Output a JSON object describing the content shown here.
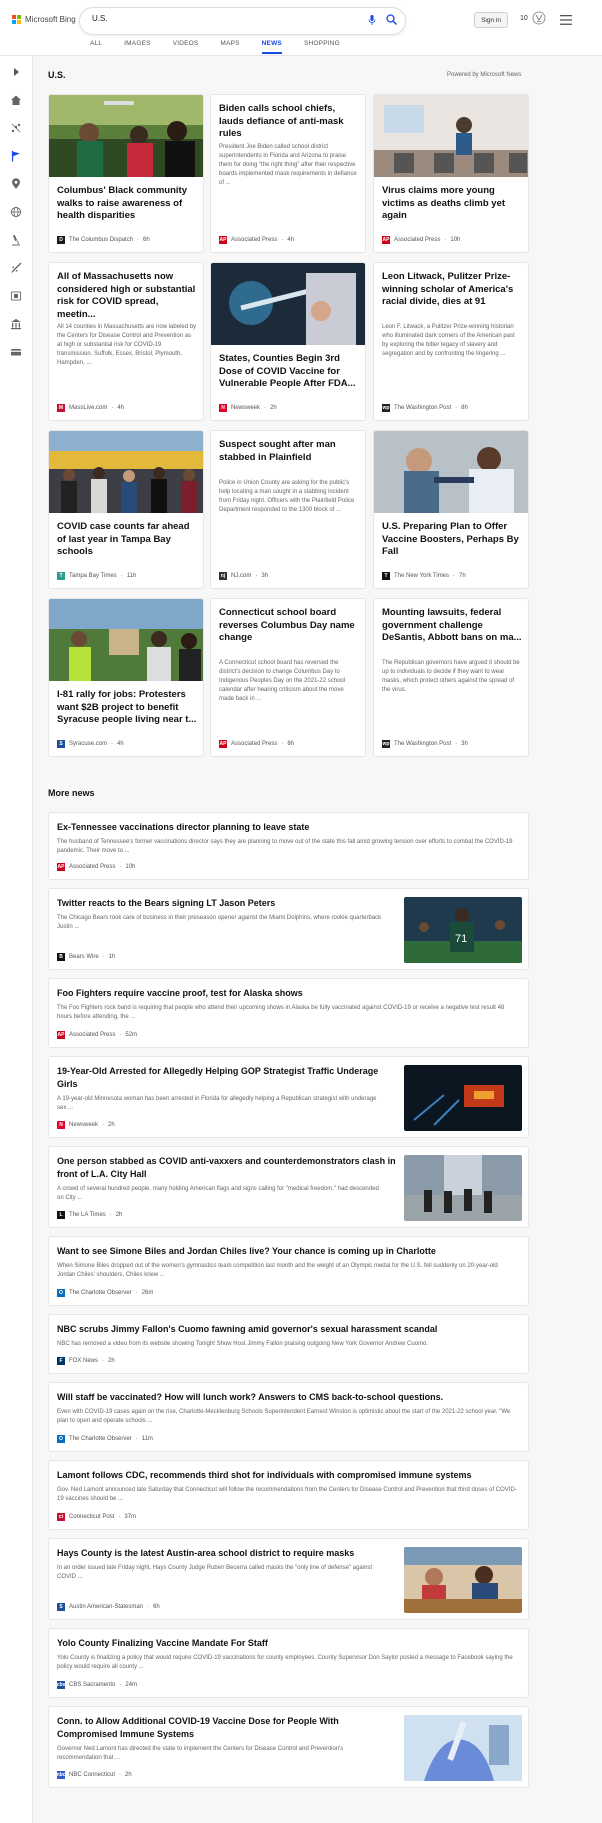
{
  "header": {
    "brand": "Microsoft Bing",
    "search_value": "U.S.",
    "signin_label": "Sign in",
    "points": "10",
    "tabs": [
      "ALL",
      "IMAGES",
      "VIDEOS",
      "MAPS",
      "NEWS",
      "SHOPPING"
    ],
    "active_tab": "NEWS"
  },
  "sidebar": {
    "icons": [
      "chevron-right-icon",
      "home-icon",
      "scatter-icon",
      "flag-icon",
      "location-pin-icon",
      "globe-icon",
      "microscope-icon",
      "rocket-icon",
      "film-icon",
      "bank-icon",
      "card-icon"
    ]
  },
  "section": {
    "title": "U.S.",
    "powered_by": "Powered by Microsoft News"
  },
  "cards": [
    {
      "title": "Columbus' Black community walks to raise awareness of health disparities",
      "snippet": "",
      "provider": "The Columbus Dispatch",
      "age": "6h",
      "icon_color": "#1a1a1a",
      "icon_letter": "D"
    },
    {
      "title": "Biden calls school chiefs, lauds defiance of anti-mask rules",
      "snippet": "President Joe Biden called school district superintendents in Florida and Arizona to praise them for doing “the right thing” after their respective boards implemented mask requirements in defiance of ...",
      "provider": "Associated Press",
      "age": "4h",
      "icon_color": "#d0021b",
      "icon_letter": "AP"
    },
    {
      "title": "Virus claims more young victims as deaths climb yet again",
      "snippet": "",
      "provider": "Associated Press",
      "age": "10h",
      "icon_color": "#d0021b",
      "icon_letter": "AP"
    },
    {
      "title": "All of Massachusetts now considered high or substantial risk for COVID spread, meetin...",
      "snippet": "All 14 counties in Massachusetts are now labeled by the Centers for Disease Control and Prevention as at high or substantial risk for COVID-19 transmission. Suffolk, Essex, Bristol, Plymouth, Hampden, ...",
      "provider": "MassLive.com",
      "age": "4h",
      "icon_color": "#c8102e",
      "icon_letter": "M"
    },
    {
      "title": "States, Counties Begin 3rd Dose of COVID Vaccine for Vulnerable People After FDA...",
      "snippet": "",
      "provider": "Newsweek",
      "age": "2h",
      "icon_color": "#e4002b",
      "icon_letter": "N"
    },
    {
      "title": "Leon Litwack, Pulitzer Prize-winning scholar of America's racial divide, dies at 91",
      "snippet": "Leon F. Litwack, a Pulitzer Prize-winning historian who illuminated dark corners of the American past by exploring the bitter legacy of slavery and segregation and by confronting the lingering ...",
      "provider": "The Washington Post",
      "age": "8h",
      "icon_color": "#222",
      "icon_letter": "wp"
    },
    {
      "title": "COVID case counts far ahead of last year in Tampa Bay schools",
      "snippet": "",
      "provider": "Tampa Bay Times",
      "age": "11h",
      "icon_color": "#2a9d8f",
      "icon_letter": "T"
    },
    {
      "title": "Suspect sought after man stabbed in Plainfield",
      "snippet": "Police in Union County are asking for the public's help locating a man sought in a stabbing incident from Friday night. Officers with the Plainfield Police Department responded to the 1300 block of ...",
      "provider": "NJ.com",
      "age": "3h",
      "icon_color": "#333",
      "icon_letter": "nj"
    },
    {
      "title": "U.S. Preparing Plan to Offer Vaccine Boosters, Perhaps By Fall",
      "snippet": "",
      "provider": "The New York Times",
      "age": "7h",
      "icon_color": "#111",
      "icon_letter": "T"
    },
    {
      "title": "I-81 rally for jobs: Protesters want $2B project to benefit Syracuse people living near t...",
      "snippet": "",
      "provider": "Syracuse.com",
      "age": "4h",
      "icon_color": "#1f4e9c",
      "icon_letter": "S"
    },
    {
      "title": "Connecticut school board reverses Columbus Day name change",
      "snippet": "A Connecticut school board has reversed the district's decision to change Columbus Day to Indigenous Peoples Day on the 2021-22 school calendar after hearing criticism about the move made back in ...",
      "provider": "Associated Press",
      "age": "8h",
      "icon_color": "#d0021b",
      "icon_letter": "AP"
    },
    {
      "title": "Mounting lawsuits, federal government challenge DeSantis, Abbott bans on ma...",
      "snippet": "The Republican governors have argued it should be up to individuals to decide if they want to wear masks, which protect others against the spread of the virus.",
      "provider": "The Washington Post",
      "age": "3h",
      "icon_color": "#222",
      "icon_letter": "wp"
    }
  ],
  "more_news": {
    "title": "More news",
    "items": [
      {
        "title": "Ex-Tennessee vaccinations director planning to leave state",
        "snippet": "The husband of Tennessee's former vaccinations director says they are planning to move out of the state this fall amid growing tension over efforts to combat the COVID-19 pandemic. Their move to ...",
        "provider": "Associated Press",
        "age": "10h",
        "icon_color": "#d0021b",
        "icon_letter": "AP"
      },
      {
        "title": "Twitter reacts to the Bears signing LT Jason Peters",
        "snippet": "The Chicago Bears took care of business in their preseason opener against the Miami Dolphins, where rookie quarterback Justin ...",
        "provider": "Bears Wire",
        "age": "1h",
        "icon_color": "#111",
        "icon_letter": "B"
      },
      {
        "title": "Foo Fighters require vaccine proof, test for Alaska shows",
        "snippet": "The Foo Fighters rock band is requiring that people who attend their upcoming shows in Alaska be fully vaccinated against COVID-19 or receive a negative test result 48 hours before attending, the ...",
        "provider": "Associated Press",
        "age": "52m",
        "icon_color": "#d0021b",
        "icon_letter": "AP"
      },
      {
        "title": "19-Year-Old Arrested for Allegedly Helping GOP Strategist Traffic Underage Girls",
        "snippet": "A 19-year-old Minnesota woman has been arrested in Florida for allegedly helping a Republican strategist with underage sex ...",
        "provider": "Newsweek",
        "age": "2h",
        "icon_color": "#e4002b",
        "icon_letter": "N"
      },
      {
        "title": "One person stabbed as COVID anti-vaxxers and counterdemonstrators clash in front of L.A. City Hall",
        "snippet": "A crowd of several hundred people, many holding American flags and signs calling for \"medical freedom,\" had descended on City ...",
        "provider": "The LA Times",
        "age": "2h",
        "icon_color": "#111",
        "icon_letter": "L"
      },
      {
        "title": "Want to see Simone Biles and Jordan Chiles live? Your chance is coming up in Charlotte",
        "snippet": "When Simone Biles dropped out of the women's gymnastics team competition last month and the weight of an Olympic medal for the U.S. fell suddenly on 20-year-old Jordan Chiles' shoulders, Chiles knew ...",
        "provider": "The Charlotte Observer",
        "age": "26m",
        "icon_color": "#0a6ebd",
        "icon_letter": "O"
      },
      {
        "title": "NBC scrubs Jimmy Fallon's Cuomo fawning amid governor's sexual harassment scandal",
        "snippet": "NBC has removed a video from its website showing Tonight Show Host Jimmy Fallon praising outgoing New York Governor Andrew Cuomo.",
        "provider": "FOX News",
        "age": "2h",
        "icon_color": "#003366",
        "icon_letter": "F"
      },
      {
        "title": "Will staff be vaccinated? How will lunch work? Answers to CMS back-to-school questions.",
        "snippet": "Even with COVID-19 cases again on the rise, Charlotte-Mecklenburg Schools Superintendent Earnest Winston is optimistic about the start of the 2021-22 school year. \"We plan to open and operate schools ...",
        "provider": "The Charlotte Observer",
        "age": "11m",
        "icon_color": "#0a6ebd",
        "icon_letter": "O"
      },
      {
        "title": "Lamont follows CDC, recommends third shot for individuals with compromised immune systems",
        "snippet": "Gov. Ned Lamont announced late Saturday that Connecticut will follow the recommendations from the Centers for Disease Control and Prevention that third doses of COVID-19 vaccines should be ...",
        "provider": "Connecticut Post",
        "age": "37m",
        "icon_color": "#c8102e",
        "icon_letter": "ct"
      },
      {
        "title": "Hays County is the latest Austin-area school district to require masks",
        "snippet": "In an order issued late Friday night, Hays County Judge Ruben Becerra called masks the \"only line of defense\" against COVID ...",
        "provider": "Austin American-Statesman",
        "age": "6h",
        "icon_color": "#1f4e9c",
        "icon_letter": "S"
      },
      {
        "title": "Yolo County Finalizing Vaccine Mandate For Staff",
        "snippet": "Yolo County is finalizing a policy that would require COVID-19 vaccinations for county employees. County Supervisor Don Saylor posted a message to Facebook saying the policy would require all county ...",
        "provider": "CBS Sacramento",
        "age": "24m",
        "icon_color": "#1f4e9c",
        "icon_letter": "cbs"
      },
      {
        "title": "Conn. to Allow Additional COVID-19 Vaccine Dose for People With Compromised Immune Systems",
        "snippet": "Governor Ned Lamont has directed the state to implement the Centers for Disease Control and Prevention's recommendation that ...",
        "provider": "NBC Connecticut",
        "age": "2h",
        "icon_color": "#2d5fd1",
        "icon_letter": "nbc"
      }
    ]
  }
}
